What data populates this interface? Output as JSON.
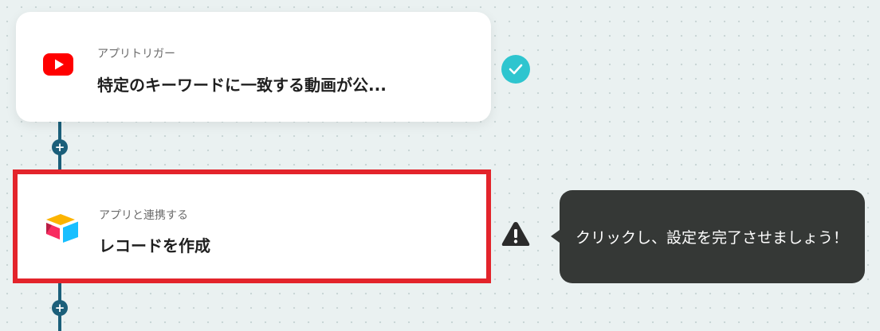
{
  "flow": {
    "trigger": {
      "subtitle": "アプリトリガー",
      "title": "特定のキーワードに一致する動画が公...",
      "icon": "youtube-icon",
      "status": "check-icon",
      "status_color": "#2ec5cf"
    },
    "action": {
      "subtitle": "アプリと連携する",
      "title": "レコードを作成",
      "icon": "airtable-icon",
      "status": "warning-icon",
      "highlight_color": "#e3242b"
    },
    "add_step_label": "+"
  },
  "tooltip": {
    "text": "クリックし、設定を完了させましょう！"
  }
}
